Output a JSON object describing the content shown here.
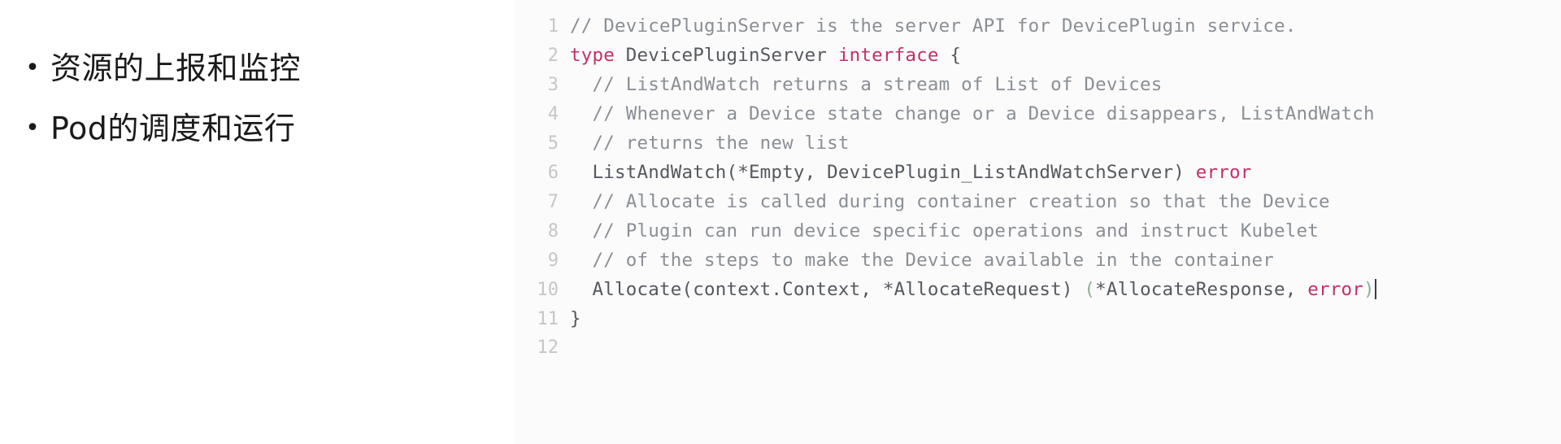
{
  "slide": {
    "background_color": "#ffffff"
  },
  "left_panel": {
    "bullet_glyph": "•",
    "bullets": [
      {
        "text": "资源的上报和监控"
      },
      {
        "text": "Pod的调度和运行"
      }
    ]
  },
  "code_panel": {
    "background_color": "#fbfbfc",
    "line_number_color": "#c6c6c6",
    "text_color": "#55595e",
    "comment_color": "#8a8f94",
    "keyword_color": "#c2306a",
    "language": "go",
    "cursor_line": 10,
    "lines": [
      {
        "number": "1",
        "text": "// DevicePluginServer is the server API for DevicePlugin service.",
        "tokens": [
          {
            "t": "// DevicePluginServer is the server API for DevicePlugin service.",
            "c": "tok-comment"
          }
        ]
      },
      {
        "number": "2",
        "text": "type DevicePluginServer interface {",
        "tokens": [
          {
            "t": "type",
            "c": "tok-kw"
          },
          {
            "t": " DevicePluginServer ",
            "c": "tok-ident"
          },
          {
            "t": "interface",
            "c": "tok-kw"
          },
          {
            "t": " {",
            "c": "tok-punct"
          }
        ]
      },
      {
        "number": "3",
        "text": "  // ListAndWatch returns a stream of List of Devices",
        "tokens": [
          {
            "t": "  // ListAndWatch returns a stream of List of Devices",
            "c": "tok-comment"
          }
        ]
      },
      {
        "number": "4",
        "text": "  // Whenever a Device state change or a Device disappears, ListAndWatch",
        "tokens": [
          {
            "t": "  // Whenever a Device state change or a Device disappears, ListAndWatch",
            "c": "tok-comment"
          }
        ]
      },
      {
        "number": "5",
        "text": "  // returns the new list",
        "tokens": [
          {
            "t": "  // returns the new list",
            "c": "tok-comment"
          }
        ]
      },
      {
        "number": "6",
        "text": "  ListAndWatch(*Empty, DevicePlugin_ListAndWatchServer) error",
        "tokens": [
          {
            "t": "  ListAndWatch(*Empty, DevicePlugin_ListAndWatchServer) ",
            "c": "tok-ident"
          },
          {
            "t": "error",
            "c": "tok-kw"
          }
        ]
      },
      {
        "number": "7",
        "text": "  // Allocate is called during container creation so that the Device",
        "tokens": [
          {
            "t": "  // Allocate is called during container creation so that the Device",
            "c": "tok-comment"
          }
        ]
      },
      {
        "number": "8",
        "text": "  // Plugin can run device specific operations and instruct Kubelet",
        "tokens": [
          {
            "t": "  // Plugin can run device specific operations and instruct Kubelet",
            "c": "tok-comment"
          }
        ]
      },
      {
        "number": "9",
        "text": "  // of the steps to make the Device available in the container",
        "tokens": [
          {
            "t": "  // of the steps to make the Device available in the container",
            "c": "tok-comment"
          }
        ]
      },
      {
        "number": "10",
        "text": "  Allocate(context.Context, *AllocateRequest) (*AllocateResponse, error)",
        "tokens": [
          {
            "t": "  Allocate(context.Context, *AllocateRequest) ",
            "c": "tok-ident"
          },
          {
            "t": "(",
            "c": "tok-paren"
          },
          {
            "t": "*AllocateResponse, ",
            "c": "tok-ident"
          },
          {
            "t": "error",
            "c": "tok-kw"
          },
          {
            "t": ")",
            "c": "tok-paren"
          }
        ],
        "has_cursor": true
      },
      {
        "number": "11",
        "text": "}",
        "tokens": [
          {
            "t": "}",
            "c": "tok-punct"
          }
        ]
      },
      {
        "number": "12",
        "text": "",
        "tokens": []
      }
    ]
  }
}
